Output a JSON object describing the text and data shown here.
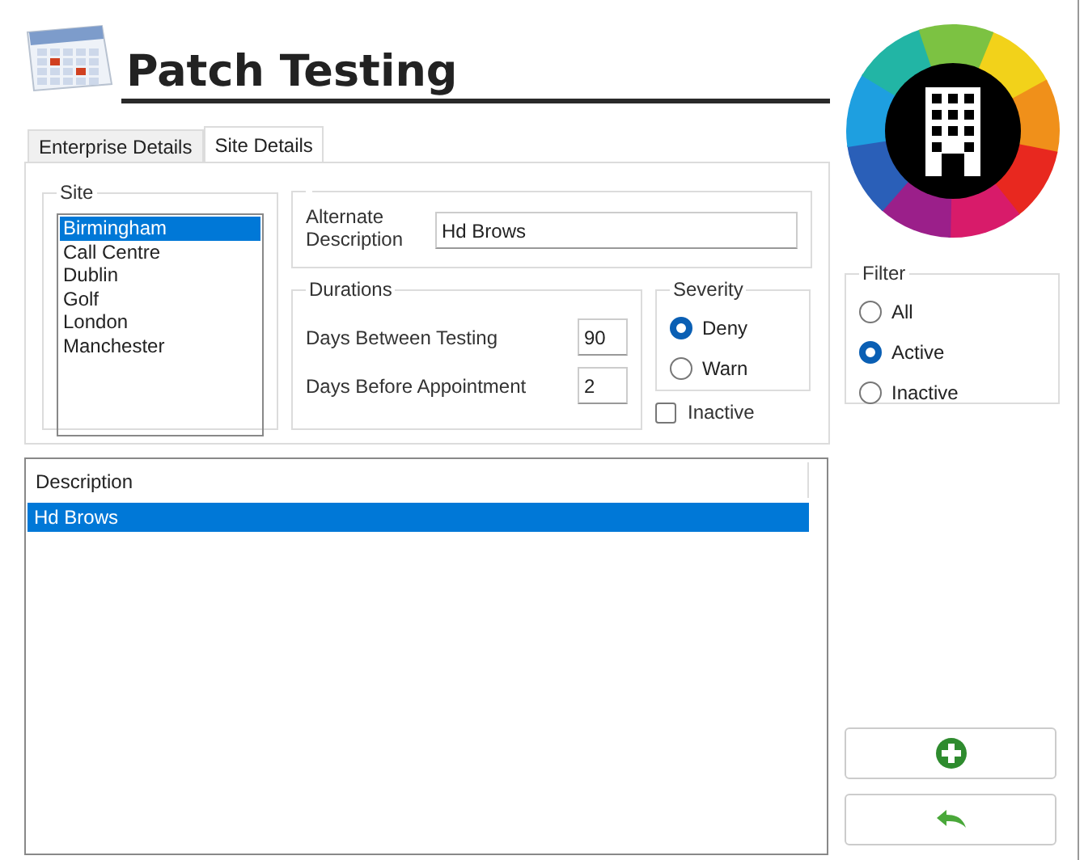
{
  "header": {
    "title": "Patch Testing"
  },
  "tabs": [
    {
      "label": "Enterprise Details",
      "selected": false
    },
    {
      "label": "Site Details",
      "selected": true
    }
  ],
  "site": {
    "legend": "Site",
    "items": [
      {
        "label": "Birmingham",
        "selected": true
      },
      {
        "label": "Call Centre",
        "selected": false
      },
      {
        "label": "Dublin",
        "selected": false
      },
      {
        "label": "Golf",
        "selected": false
      },
      {
        "label": "London",
        "selected": false
      },
      {
        "label": "Manchester",
        "selected": false
      }
    ]
  },
  "alternate": {
    "label": "Alternate Description",
    "value": "Hd Brows"
  },
  "durations": {
    "legend": "Durations",
    "fields": [
      {
        "label": "Days Between Testing",
        "value": "90"
      },
      {
        "label": "Days Before Appointment",
        "value": "2"
      }
    ]
  },
  "severity": {
    "legend": "Severity",
    "options": [
      {
        "label": "Deny",
        "selected": true
      },
      {
        "label": "Warn",
        "selected": false
      }
    ]
  },
  "inactive": {
    "label": "Inactive",
    "checked": false
  },
  "grid": {
    "columns": [
      "Description"
    ],
    "rows": [
      {
        "cells": [
          "Hd Brows"
        ],
        "selected": true
      }
    ]
  },
  "filter": {
    "legend": "Filter",
    "options": [
      {
        "label": "All",
        "selected": false
      },
      {
        "label": "Active",
        "selected": true
      },
      {
        "label": "Inactive",
        "selected": false
      }
    ]
  },
  "buttons": [
    {
      "kind": "add"
    },
    {
      "kind": "undo"
    }
  ]
}
